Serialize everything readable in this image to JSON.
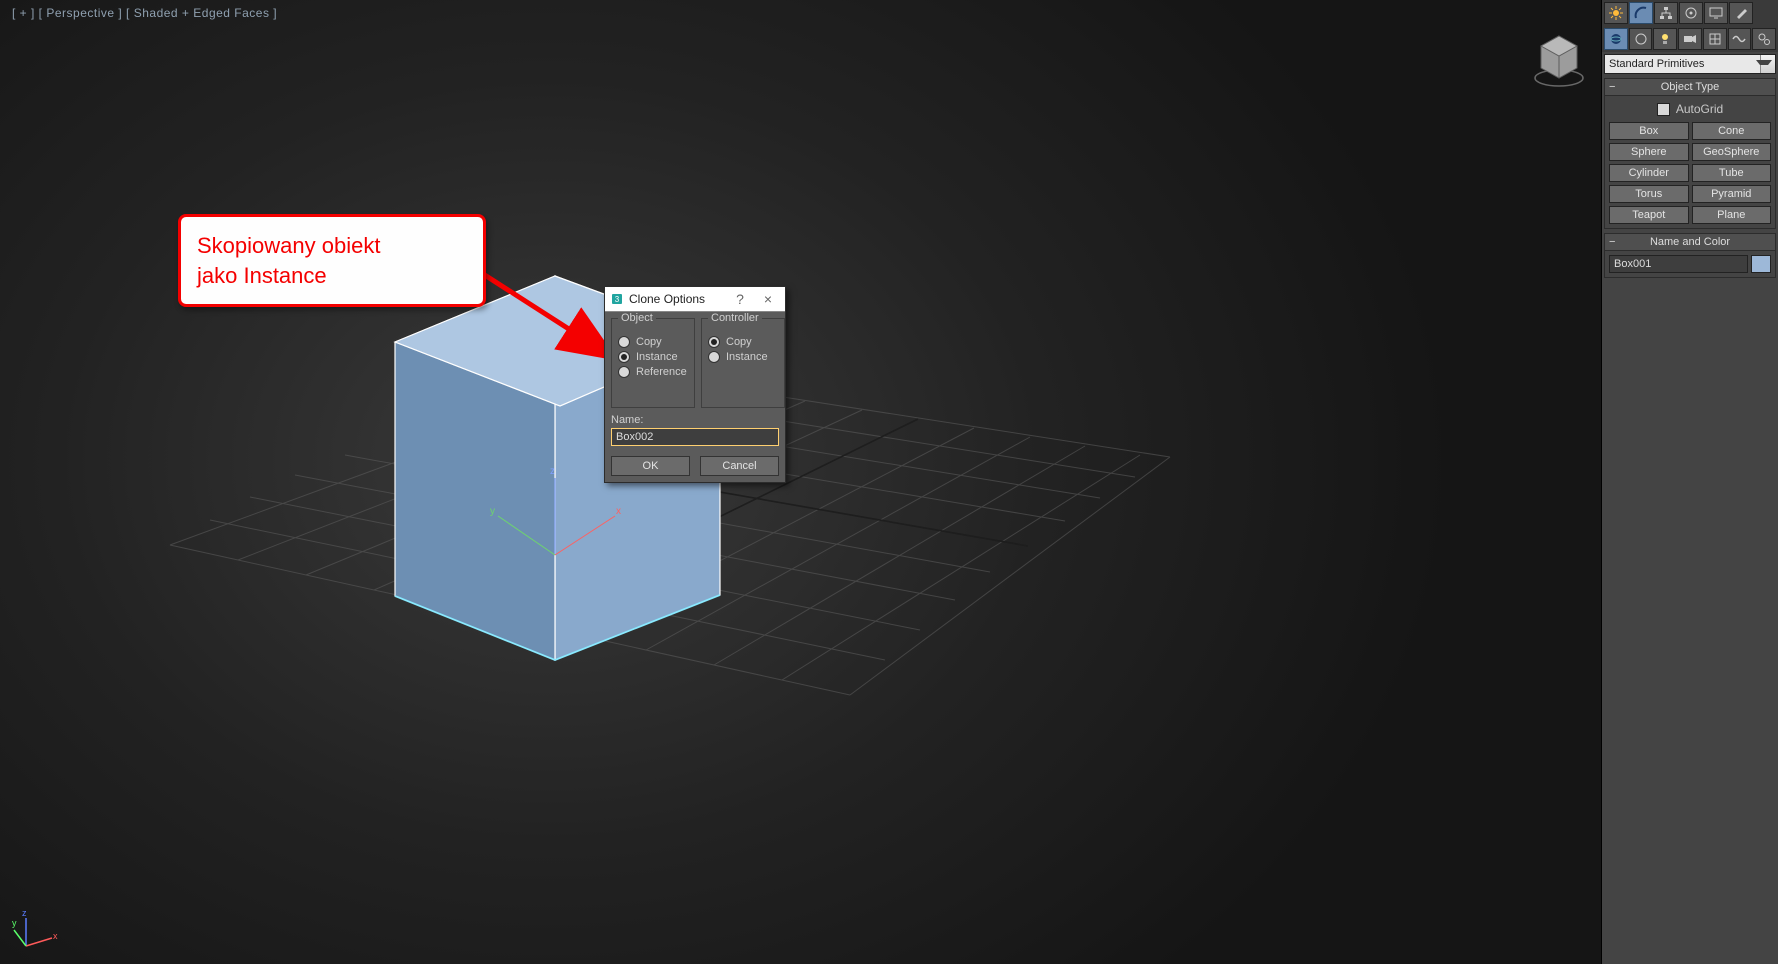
{
  "viewport": {
    "label": "[ + ] [ Perspective ] [ Shaded + Edged Faces ]"
  },
  "callout": {
    "line1": "Skopiowany obiekt",
    "line2": "jako Instance"
  },
  "dialog": {
    "title": "Clone Options",
    "help": "?",
    "close": "×",
    "group_object": "Object",
    "group_controller": "Controller",
    "opt_copy": "Copy",
    "opt_instance": "Instance",
    "opt_reference": "Reference",
    "name_label": "Name:",
    "name_value": "Box002",
    "ok": "OK",
    "cancel": "Cancel",
    "object_selected": "Instance",
    "controller_selected": "Copy"
  },
  "panel": {
    "top_tabs": [
      "create",
      "modify",
      "hierarchy",
      "motion",
      "display",
      "utilities"
    ],
    "sub_tabs": [
      "geometry",
      "shapes",
      "lights",
      "cameras",
      "helpers",
      "spacewarps",
      "systems"
    ],
    "dropdown": "Standard Primitives",
    "rollout_object_type": "Object Type",
    "autogrid": "AutoGrid",
    "buttons": [
      "Box",
      "Cone",
      "Sphere",
      "GeoSphere",
      "Cylinder",
      "Tube",
      "Torus",
      "Pyramid",
      "Teapot",
      "Plane"
    ],
    "rollout_name_color": "Name and Color",
    "object_name": "Box001"
  },
  "icons": {
    "top": [
      "sun-icon",
      "arc-icon",
      "hierarchy-icon",
      "motion-icon",
      "display-icon",
      "hammer-icon"
    ],
    "sub": [
      "sphere-icon",
      "shape-icon",
      "light-icon",
      "camera-icon",
      "helper-icon",
      "warp-icon",
      "system-icon"
    ]
  }
}
